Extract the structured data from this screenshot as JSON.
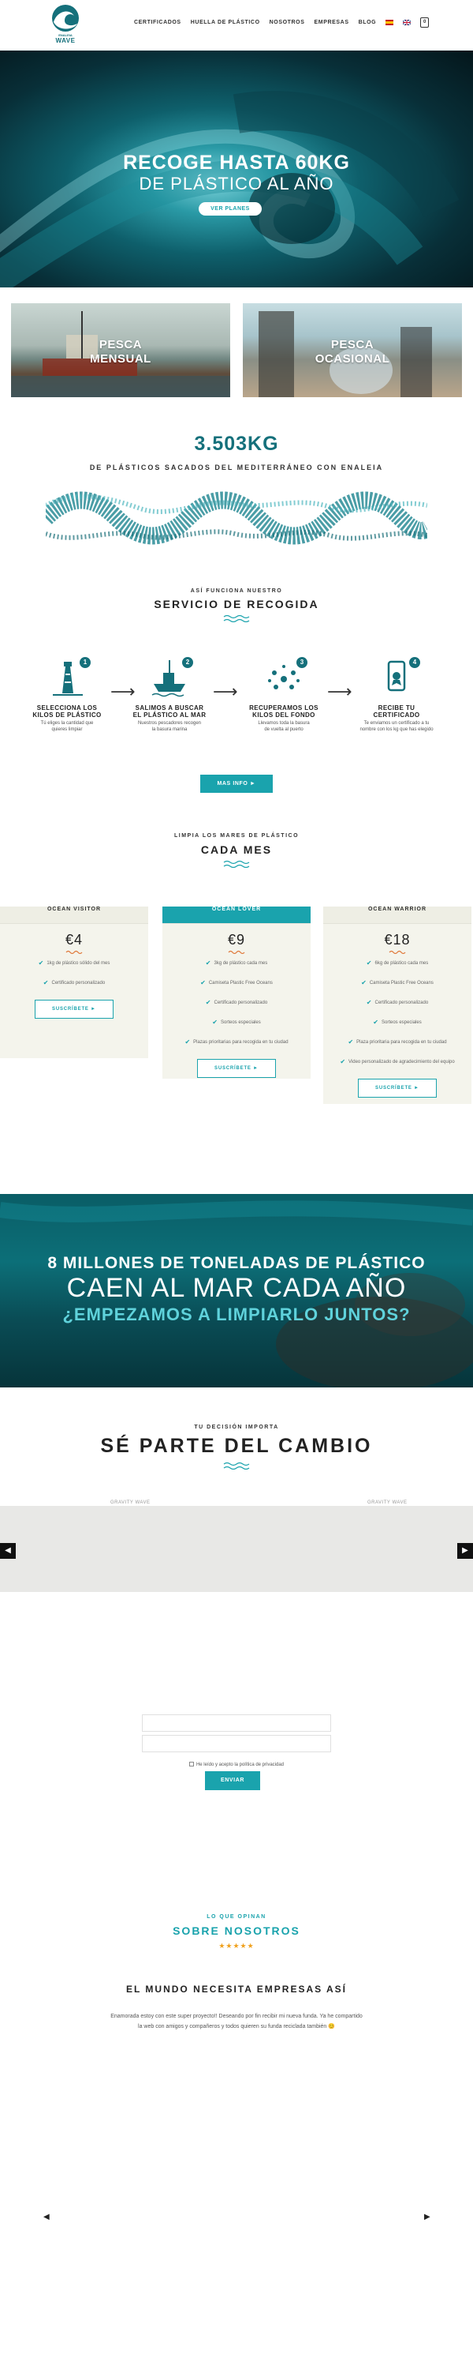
{
  "brand": {
    "tagline": "ENALEIA",
    "name": "WAVE"
  },
  "nav": {
    "items": [
      "CERTIFICADOS",
      "HUELLA DE PLÁSTICO",
      "NOSOTROS",
      "EMPRESAS",
      "BLOG"
    ],
    "cart_count": "0",
    "flags": [
      "es-flag",
      "uk-flag"
    ]
  },
  "hero": {
    "title_line1": "RECOGE HASTA 60KG",
    "title_line2": "DE PLÁSTICO AL AÑO",
    "button": "VER PLANES"
  },
  "cards": [
    {
      "line1": "PESCA",
      "line2": "MENSUAL"
    },
    {
      "line1": "PESCA",
      "line2": "OCASIONAL"
    }
  ],
  "counter": {
    "value": "3.503KG",
    "subtitle": "DE PLÁSTICOS SACADOS DEL MEDITERRÁNEO CON ENALEIA"
  },
  "service": {
    "eyebrow": "ASÍ FUNCIONA NUESTRO",
    "title": "SERVICIO DE RECOGIDA",
    "steps": [
      {
        "num": "1",
        "title1": "SELECCIONA LOS",
        "title2": "KILOS DE PLÁSTICO",
        "desc1": "Tú eliges la cantidad que",
        "desc2": "quieres limpiar"
      },
      {
        "num": "2",
        "title1": "SALIMOS A BUSCAR",
        "title2": "EL PLÁSTICO AL MAR",
        "desc1": "Nuestros pescadores recogen",
        "desc2": "la basura marina"
      },
      {
        "num": "3",
        "title1": "RECUPERAMOS LOS",
        "title2": "KILOS DEL FONDO",
        "desc1": "Llevamos toda la basura",
        "desc2": "de vuelta al puerto"
      },
      {
        "num": "4",
        "title1": "RECIBE TU",
        "title2": "CERTIFICADO",
        "desc1": "Te enviamos un certificado a tu",
        "desc2": "nombre con los kg que has elegido"
      }
    ],
    "button": "MAS INFO ►"
  },
  "plans_intro": {
    "eyebrow": "LIMPIA LOS MARES DE PLÁSTICO",
    "title": "CADA MES"
  },
  "plans": [
    {
      "name": "OCEAN VISITOR",
      "price": "€4",
      "featured": false,
      "features": [
        "1kg de plástico sólido del mes",
        "Certificado personalizado"
      ],
      "button": "SUSCRÍBETE ►"
    },
    {
      "name": "OCEAN LOVER",
      "price": "€9",
      "featured": true,
      "features": [
        "3kg de plástico cada mes",
        "Camiseta Plastic Free Oceans",
        "Certificado personalizado",
        "Sorteos especiales",
        "Plazas prioritarias para recogida en tu ciudad"
      ],
      "button": "SUSCRÍBETE ►"
    },
    {
      "name": "OCEAN WARRIOR",
      "price": "€18",
      "featured": false,
      "features": [
        "6kg de plástico cada mes",
        "Camiseta Plastic Free Oceans",
        "Certificado personalizado",
        "Sorteos especiales",
        "Plaza prioritaria para recogida en tu ciudad",
        "Video personalizado de agradecimiento del equipo"
      ],
      "button": "SUSCRÍBETE ►"
    }
  ],
  "band": {
    "line1": "8 MILLONES DE TONELADAS DE PLÁSTICO",
    "line2": "CAEN AL MAR CADA AÑO",
    "line3": "¿EMPEZAMOS A LIMPIARLO JUNTOS?"
  },
  "change": {
    "eyebrow": "TU DECISIÓN IMPORTA",
    "title": "SÉ PARTE DEL CAMBIO",
    "slide_captions": [
      "GRAVITY WAVE",
      "GRAVITY WAVE"
    ]
  },
  "form": {
    "consent": "He leído y acepto la política de privacidad",
    "submit": "ENVIAR"
  },
  "testimonials": {
    "eyebrow": "LO QUE OPINAN",
    "title": "SOBRE NOSOTROS",
    "stars": "★★★★★",
    "quote_title": "EL MUNDO NECESITA EMPRESAS ASÍ",
    "quote_line1": "Enamorada estoy con este super proyecto!! Deseando por fin recibir mi nueva funda. Ya he compartido",
    "quote_line2": "la web con amigos y compañeros y todos quieren su funda reciclada también 😊"
  },
  "colors": {
    "accent": "#1aa3ad",
    "dark_teal": "#15707b",
    "star": "#f0a11e"
  }
}
